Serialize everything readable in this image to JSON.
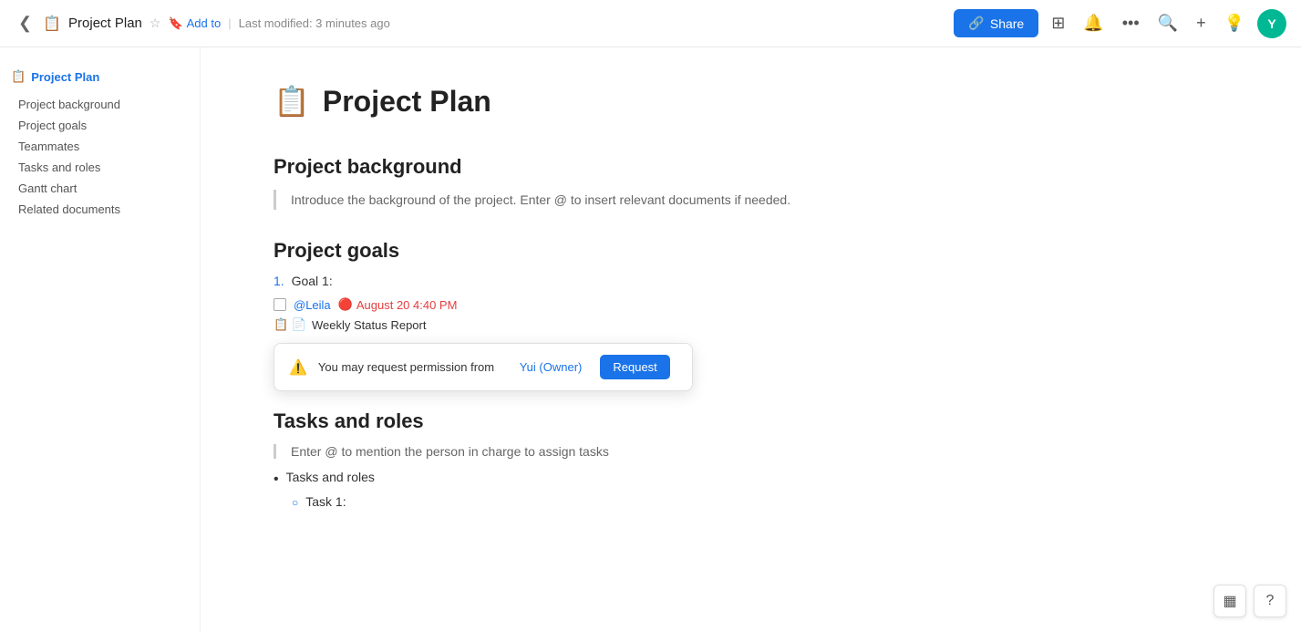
{
  "topbar": {
    "back_icon": "◀",
    "doc_icon": "📋",
    "doc_title": "Project Plan",
    "star_icon": "☆",
    "add_to_label": "Add to",
    "add_to_icon": "🔖",
    "separator": "|",
    "last_modified": "Last modified: 3 minutes ago",
    "share_icon": "🔗",
    "share_label": "Share",
    "present_icon": "▦",
    "bell_icon": "🔔",
    "more_icon": "···",
    "search_icon": "🔍",
    "plus_icon": "+",
    "bulb_icon": "💡",
    "avatar_label": "Y"
  },
  "sidebar": {
    "title": "Project Plan",
    "title_icon": "📋",
    "items": [
      {
        "label": "Project background",
        "id": "project-background"
      },
      {
        "label": "Project goals",
        "id": "project-goals"
      },
      {
        "label": "Teammates",
        "id": "teammates"
      },
      {
        "label": "Tasks and roles",
        "id": "tasks-and-roles"
      },
      {
        "label": "Gantt chart",
        "id": "gantt-chart"
      },
      {
        "label": "Related documents",
        "id": "related-documents"
      }
    ]
  },
  "page": {
    "title_icon": "📋",
    "title": "Project Plan",
    "sections": {
      "background": {
        "heading": "Project background",
        "placeholder": "Introduce the background of the project. Enter @ to insert relevant documents if needed."
      },
      "goals": {
        "heading": "Project goals",
        "goal_number": "1.",
        "goal_label": "Goal 1:",
        "assignee": "@Leila",
        "date": "August 20 4:40 PM",
        "linked_doc_icons": "📋 📄",
        "linked_doc_label": "Weekly Status Report",
        "permission_icon": "⚠",
        "permission_text": "You may request permission from",
        "owner_label": "Yui (Owner)",
        "request_label": "Request"
      },
      "tasks": {
        "heading": "Tasks and roles",
        "placeholder": "Enter @ to mention the person in charge to assign tasks",
        "bullet_label": "Tasks and roles",
        "sub_bullet_label": "Task 1:"
      }
    }
  },
  "bottom_right": {
    "table_icon": "▦",
    "help_icon": "?"
  }
}
